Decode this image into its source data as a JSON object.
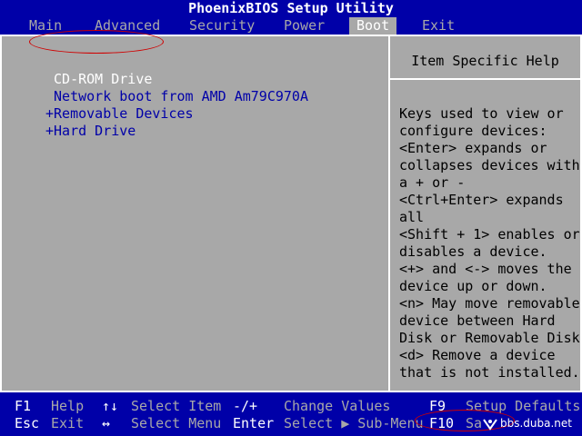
{
  "title": "PhoenixBIOS Setup Utility",
  "menu": [
    {
      "label": "Main"
    },
    {
      "label": "Advanced"
    },
    {
      "label": "Security"
    },
    {
      "label": "Power"
    },
    {
      "label": "Boot",
      "active": true
    },
    {
      "label": "Exit"
    }
  ],
  "boot_items": [
    {
      "label": " CD-ROM Drive",
      "selected": true
    },
    {
      "label": " Network boot from AMD Am79C970A"
    },
    {
      "label": "+Removable Devices"
    },
    {
      "label": "+Hard Drive"
    }
  ],
  "help": {
    "title": "Item Specific Help",
    "lines": [
      "Keys used to view or",
      "configure devices:",
      "<Enter> expands or",
      "collapses devices with",
      "a + or -",
      "<Ctrl+Enter> expands",
      "all",
      "<Shift + 1> enables or",
      "disables a device.",
      "<+> and <-> moves the",
      "device up or down.",
      "<n> May move removable",
      "device between Hard",
      "Disk or Removable Disk",
      "<d> Remove a device",
      "that is not installed."
    ]
  },
  "footer": {
    "row1": {
      "k1": "F1",
      "d1": "Help",
      "k2": "↑↓",
      "d2": "Select Item",
      "k3": "-/+",
      "d3": "Change Values",
      "k4": "F9",
      "d4": "Setup Defaults"
    },
    "row2": {
      "k1": "Esc",
      "d1": "Exit",
      "k2": "↔",
      "d2": "Select Menu",
      "k3": "Enter",
      "d3": "Select ▶ Sub-Menu",
      "k4": "F10",
      "d4": "Sa"
    }
  },
  "watermark": "bbs.duba.net",
  "colors": {
    "bios_blue": "#0000a8",
    "bios_gray": "#a8a8a8",
    "annotation_red": "#d00000"
  }
}
